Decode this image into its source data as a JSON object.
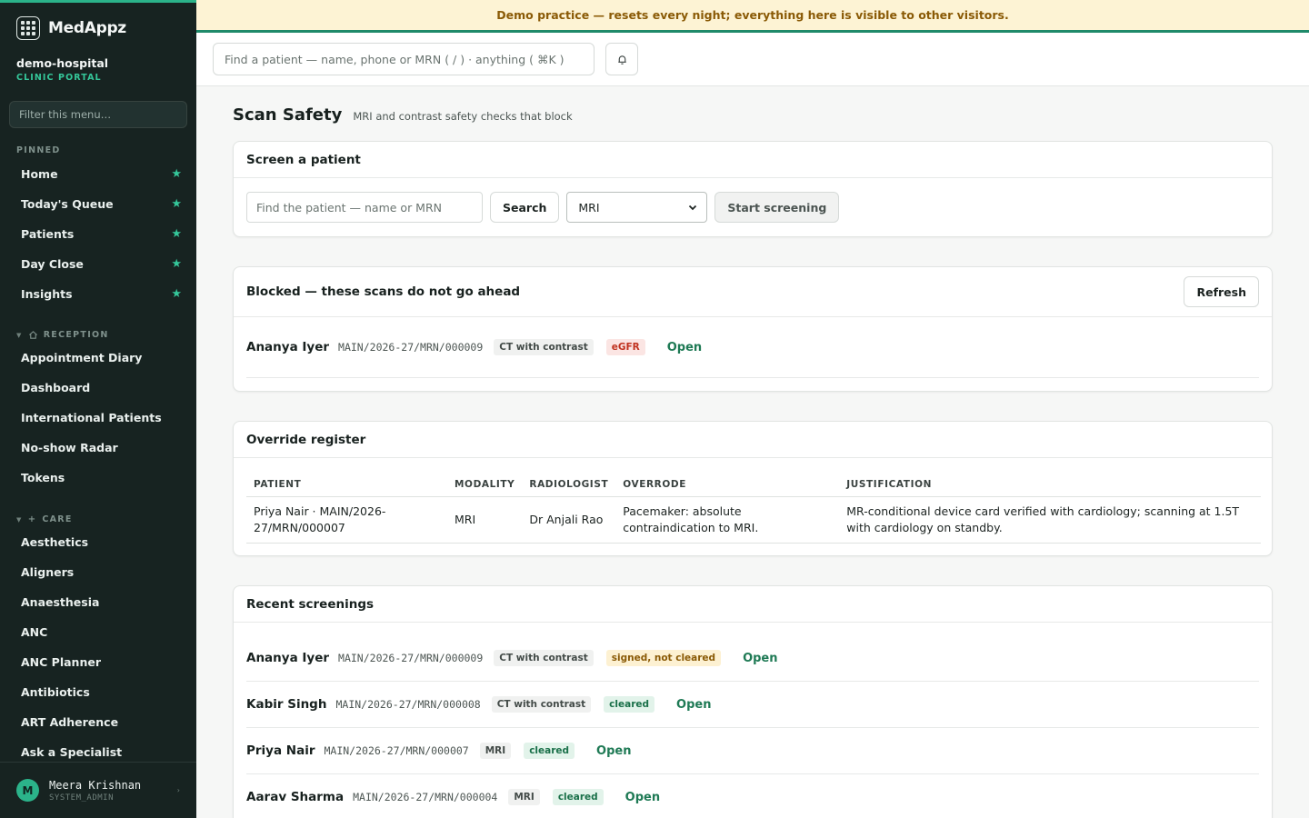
{
  "app": {
    "name": "MedAppz",
    "org": "demo-hospital",
    "org_sub": "CLINIC PORTAL"
  },
  "banner": "Demo practice — resets every night; everything here is visible to other visitors.",
  "sidebar": {
    "filter_placeholder": "Filter this menu…",
    "pinned_title": "PINNED",
    "pinned": [
      {
        "label": "Home"
      },
      {
        "label": "Today's Queue"
      },
      {
        "label": "Patients"
      },
      {
        "label": "Day Close"
      },
      {
        "label": "Insights"
      }
    ],
    "reception_title": "RECEPTION",
    "reception": [
      {
        "label": "Appointment Diary"
      },
      {
        "label": "Dashboard"
      },
      {
        "label": "International Patients"
      },
      {
        "label": "No-show Radar"
      },
      {
        "label": "Tokens"
      }
    ],
    "care_title": "CARE",
    "care": [
      {
        "label": "Aesthetics"
      },
      {
        "label": "Aligners"
      },
      {
        "label": "Anaesthesia"
      },
      {
        "label": "ANC"
      },
      {
        "label": "ANC Planner"
      },
      {
        "label": "Antibiotics"
      },
      {
        "label": "ART Adherence"
      },
      {
        "label": "Ask a Specialist"
      }
    ],
    "user": {
      "initial": "M",
      "name": "Meera Krishnan",
      "role": "SYSTEM_ADMIN"
    }
  },
  "topbar": {
    "search_placeholder": "Find a patient — name, phone or MRN ( / ) · anything ( ⌘K )"
  },
  "page": {
    "title": "Scan Safety",
    "subtitle": "MRI and contrast safety checks that block"
  },
  "screen_card": {
    "title": "Screen a patient",
    "patient_placeholder": "Find the patient — name or MRN",
    "search_label": "Search",
    "modality_value": "MRI",
    "start_label": "Start screening"
  },
  "blocked_card": {
    "title": "Blocked — these scans do not go ahead",
    "refresh_label": "Refresh",
    "rows": [
      {
        "name": "Ananya Iyer",
        "mrn": "MAIN/2026-27/MRN/000009",
        "scan": "CT with contrast",
        "reason": "eGFR",
        "action": "Open"
      }
    ]
  },
  "override_card": {
    "title": "Override register",
    "columns": [
      "PATIENT",
      "MODALITY",
      "RADIOLOGIST",
      "OVERRODE",
      "JUSTIFICATION"
    ],
    "rows": [
      {
        "patient": "Priya Nair · MAIN/2026-27/MRN/000007",
        "modality": "MRI",
        "radiologist": "Dr Anjali Rao",
        "overrode": "Pacemaker: absolute contraindication to MRI.",
        "justification": "MR-conditional device card verified with cardiology; scanning at 1.5T with cardiology on standby."
      }
    ]
  },
  "recent_card": {
    "title": "Recent screenings",
    "rows": [
      {
        "name": "Ananya Iyer",
        "mrn": "MAIN/2026-27/MRN/000009",
        "scan": "CT with contrast",
        "status": "signed, not cleared",
        "status_kind": "yellow",
        "action": "Open"
      },
      {
        "name": "Kabir Singh",
        "mrn": "MAIN/2026-27/MRN/000008",
        "scan": "CT with contrast",
        "status": "cleared",
        "status_kind": "green",
        "action": "Open"
      },
      {
        "name": "Priya Nair",
        "mrn": "MAIN/2026-27/MRN/000007",
        "scan": "MRI",
        "status": "cleared",
        "status_kind": "green",
        "action": "Open"
      },
      {
        "name": "Aarav Sharma",
        "mrn": "MAIN/2026-27/MRN/000004",
        "scan": "MRI",
        "status": "cleared",
        "status_kind": "green",
        "action": "Open"
      }
    ]
  },
  "colors": {
    "accent": "#2bb38a",
    "sidebar_bg": "#172321",
    "banner_bg": "#fdf3d4",
    "link": "#1f7a55"
  }
}
